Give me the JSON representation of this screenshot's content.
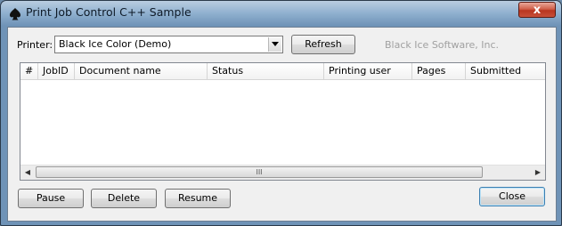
{
  "window": {
    "title": "Print Job Control C++ Sample",
    "close_glyph": "x"
  },
  "printer": {
    "label": "Printer:",
    "selected": "Black Ice Color (Demo)"
  },
  "toolbar": {
    "refresh_label": "Refresh",
    "company": "Black Ice Software, Inc."
  },
  "jobs_table": {
    "columns": [
      "#",
      "JobID",
      "Document name",
      "Status",
      "Printing user",
      "Pages",
      "Submitted"
    ],
    "rows": [],
    "thumb_grip": "III"
  },
  "actions": {
    "pause_label": "Pause",
    "delete_label": "Delete",
    "resume_label": "Resume",
    "close_label": "Close"
  },
  "colors": {
    "title_bar": "#8fb0cf",
    "close_button": "#c8503a",
    "client_bg": "#f0f0f0"
  }
}
